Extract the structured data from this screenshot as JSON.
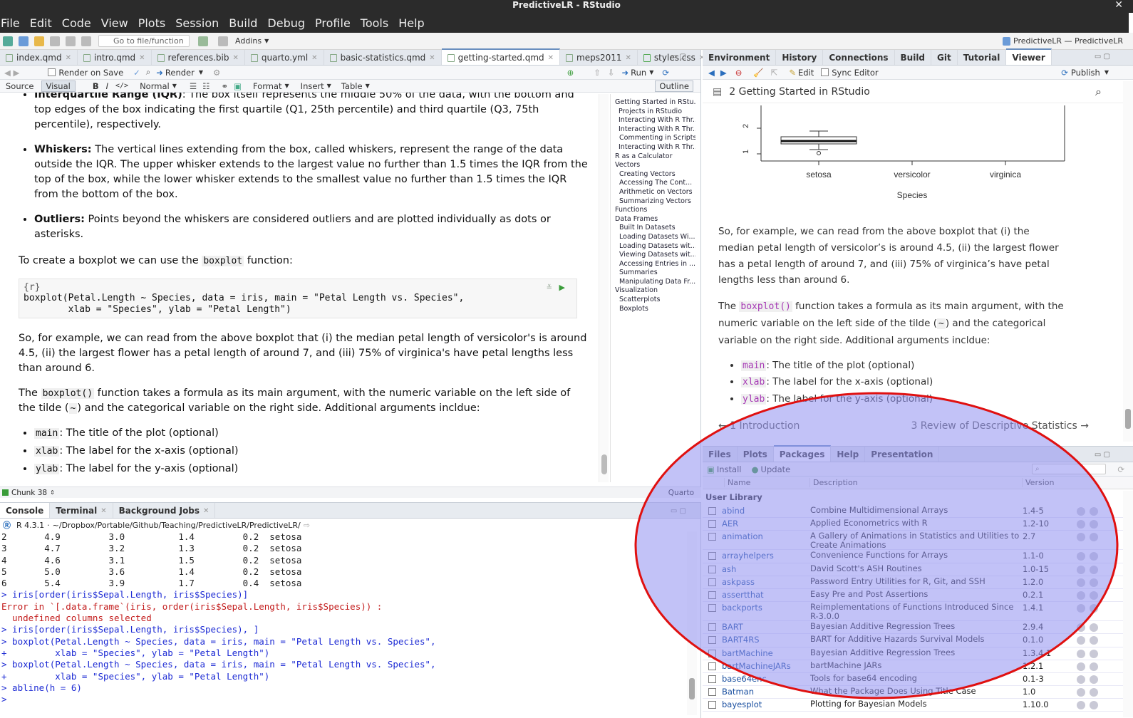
{
  "window": {
    "title": "PredictiveLR - RStudio",
    "close": "✕"
  },
  "menu": [
    "File",
    "Edit",
    "Code",
    "View",
    "Plots",
    "Session",
    "Build",
    "Debug",
    "Profile",
    "Tools",
    "Help"
  ],
  "toolbar": {
    "goto_placeholder": "Go to file/function",
    "addins": "Addins",
    "project": "PredictiveLR — PredictiveLR"
  },
  "editor": {
    "tabs": [
      "index.qmd",
      "intro.qmd",
      "references.bib",
      "quarto.yml",
      "basic-statistics.qmd",
      "getting-started.qmd",
      "meps2011",
      "styles.css"
    ],
    "active_tab": "getting-started.qmd",
    "render_on_save": "Render on Save",
    "render": "Render",
    "run": "Run",
    "source": "Source",
    "visual": "Visual",
    "normal": "Normal",
    "format": "Format",
    "insert": "Insert",
    "table": "Table",
    "outline": "Outline",
    "iqr_bold": "Interquartile Range (IQR)",
    "iqr_text_top": ": The box itself represents the middle 50% of the data, with the bottom and",
    "iqr_text_rest": "top edges of the box indicating the first quartile (Q1, 25th percentile) and third quartile (Q3, 75th percentile), respectively.",
    "whiskers_bold": "Whiskers:",
    "whiskers_text": "The vertical lines extending from the box, called whiskers, represent the range of the data outside the IQR. The upper whisker extends to the largest value no further than 1.5 times the IQR from the top of the box, while the lower whisker extends to the smallest value no further than 1.5 times the IQR from the bottom of the box.",
    "outliers_bold": "Outliers:",
    "outliers_text": "Points beyond the whiskers are considered outliers and are plotted individually as dots or asterisks.",
    "create_pre": "To create a boxplot we can use the",
    "create_code": "boxplot",
    "create_post": "function:",
    "chunk_header": "{r}",
    "chunk_line1": "boxplot(Petal.Length ~ Species, data = iris, main = \"Petal Length vs. Species\",",
    "chunk_line2": "        xlab = \"Species\", ylab = \"Petal Length\")",
    "para1": "So, for example, we can read from the above boxplot that (i) the median petal length of versicolor's is around 4.5, (ii) the largest flower has a petal length of around 7, and (iii) 75% of virginica's have petal lengths less than around 6.",
    "para2_pre": "The",
    "para2_code": "boxplot()",
    "para2_mid": "function takes a formula as its main argument, with the numeric variable on the left side of the tilde (",
    "para2_tilde": "~",
    "para2_post": ") and the categorical variable on the right side. Additional arguments incldue:",
    "args": [
      {
        "code": "main",
        "text": ": The title of the plot (optional)"
      },
      {
        "code": "xlab",
        "text": ": The label for the x-axis (optional)"
      },
      {
        "code": "ylab",
        "text": ": The label for the y-axis (optional)"
      }
    ],
    "status_chunk": "Chunk 38",
    "status_mode": "Quarto"
  },
  "outline": [
    "Getting Started in RStu...",
    "Projects in RStudio",
    "Interacting With R Thr...",
    "Interacting With R Thr...",
    "Commenting in Scripts",
    "Interacting With R Thr...",
    "R as a Calculator",
    "Vectors",
    "Creating Vectors",
    "Accessing The Cont...",
    "Arithmetic on Vectors",
    "Summarizing Vectors",
    "Functions",
    "Data Frames",
    "Built In Datasets",
    "Loading Datasets Wi...",
    "Loading Datasets wit...",
    "Viewing Datasets wit...",
    "Accessing Entries in ...",
    "Summaries",
    "Manipulating Data Fr...",
    "Visualization",
    "Scatterplots",
    "Boxplots"
  ],
  "console": {
    "tabs": [
      "Console",
      "Terminal",
      "Background Jobs"
    ],
    "version": "R 4.3.1",
    "path": "~/Dropbox/Portable/Github/Teaching/PredictiveLR/PredictiveLR/",
    "lines": [
      {
        "t": "2       4.9         3.0          1.4         0.2  setosa",
        "c": "#222"
      },
      {
        "t": "3       4.7         3.2          1.3         0.2  setosa",
        "c": "#222"
      },
      {
        "t": "4       4.6         3.1          1.5         0.2  setosa",
        "c": "#222"
      },
      {
        "t": "5       5.0         3.6          1.4         0.2  setosa",
        "c": "#222"
      },
      {
        "t": "6       5.4         3.9          1.7         0.4  setosa",
        "c": "#222"
      },
      {
        "t": "> iris[order(iris$Sepal.Length, iris$Species)]",
        "c": "#1d2bd4"
      },
      {
        "t": "Error in `[.data.frame`(iris, order(iris$Sepal.Length, iris$Species)) :",
        "c": "#c31d1d"
      },
      {
        "t": "  undefined columns selected",
        "c": "#c31d1d"
      },
      {
        "t": "> iris[order(iris$Sepal.Length, iris$Species), ]",
        "c": "#1d2bd4"
      },
      {
        "t": "> boxplot(Petal.Length ~ Species, data = iris, main = \"Petal Length vs. Species\",",
        "c": "#1d2bd4"
      },
      {
        "t": "+         xlab = \"Species\", ylab = \"Petal Length\")",
        "c": "#1d2bd4"
      },
      {
        "t": "> boxplot(Petal.Length ~ Species, data = iris, main = \"Petal Length vs. Species\",",
        "c": "#1d2bd4"
      },
      {
        "t": "+         xlab = \"Species\", ylab = \"Petal Length\")",
        "c": "#1d2bd4"
      },
      {
        "t": "> abline(h = 6)",
        "c": "#1d2bd4"
      },
      {
        "t": "> ",
        "c": "#1d2bd4"
      }
    ]
  },
  "env": {
    "tabs": [
      "Environment",
      "History",
      "Connections",
      "Build",
      "Git",
      "Tutorial",
      "Viewer"
    ],
    "edit": "Edit",
    "sync": "Sync Editor",
    "publish": "Publish"
  },
  "viewer": {
    "page_title": "2  Getting Started in RStudio",
    "ytick_2": "2",
    "ytick_1": "1",
    "cat1": "setosa",
    "cat2": "versicolor",
    "cat3": "virginica",
    "xlabel": "Species",
    "para1": "So, for example, we can read from the above boxplot that (i) the median petal length of versicolor’s is around 4.5, (ii) the largest flower has a petal length of around 7, and (iii) 75% of virginica’s have petal lengths less than around 6.",
    "para2_pre": "The",
    "para2_code": "boxplot()",
    "para2_mid": "function takes a formula as its main argument, with the numeric variable on the left side of the tilde (",
    "para2_tilde": "~",
    "para2_post": ") and the categorical variable on the right side. Additional arguments incldue:",
    "args": [
      {
        "code": "main",
        "text": ": The title of the plot (optional)"
      },
      {
        "code": "xlab",
        "text": ": The label for the x-axis (optional)"
      },
      {
        "code": "ylab",
        "text": ": The label for the y-axis (optional)"
      }
    ],
    "prev": "1  Introduction",
    "next": "3  Review of Descriptive Statistics"
  },
  "files": {
    "tabs": [
      "Files",
      "Plots",
      "Packages",
      "Help",
      "Presentation"
    ],
    "install": "Install",
    "update": "Update",
    "col_name": "Name",
    "col_desc": "Description",
    "col_ver": "Version",
    "user_library": "User Library",
    "packages": [
      {
        "name": "abind",
        "desc": "Combine Multidimensional Arrays",
        "ver": "1.4-5"
      },
      {
        "name": "AER",
        "desc": "Applied Econometrics with R",
        "ver": "1.2-10"
      },
      {
        "name": "animation",
        "desc": "A Gallery of Animations in Statistics and Utilities to Create Animations",
        "ver": "2.7"
      },
      {
        "name": "arrayhelpers",
        "desc": "Convenience Functions for Arrays",
        "ver": "1.1-0"
      },
      {
        "name": "ash",
        "desc": "David Scott's ASH Routines",
        "ver": "1.0-15"
      },
      {
        "name": "askpass",
        "desc": "Password Entry Utilities for R, Git, and SSH",
        "ver": "1.2.0"
      },
      {
        "name": "assertthat",
        "desc": "Easy Pre and Post Assertions",
        "ver": "0.2.1"
      },
      {
        "name": "backports",
        "desc": "Reimplementations of Functions Introduced Since R-3.0.0",
        "ver": "1.4.1"
      },
      {
        "name": "BART",
        "desc": "Bayesian Additive Regression Trees",
        "ver": "2.9.4"
      },
      {
        "name": "BART4RS",
        "desc": "BART for Additive Hazards Survival Models",
        "ver": "0.1.0"
      },
      {
        "name": "bartMachine",
        "desc": "Bayesian Additive Regression Trees",
        "ver": "1.3.4.1"
      },
      {
        "name": "bartMachineJARs",
        "desc": "bartMachine JARs",
        "ver": "1.2.1"
      },
      {
        "name": "base64enc",
        "desc": "Tools for base64 encoding",
        "ver": "0.1-3"
      },
      {
        "name": "Batman",
        "desc": "What the Package Does Using Title Case",
        "ver": "1.0"
      },
      {
        "name": "bayesplot",
        "desc": "Plotting for Bayesian Models",
        "ver": "1.10.0"
      }
    ]
  },
  "colors": {
    "annotation_fill": "#8f8ff0",
    "annotation_stroke": "#e01010",
    "dark_bar": "#2b2b2b"
  }
}
